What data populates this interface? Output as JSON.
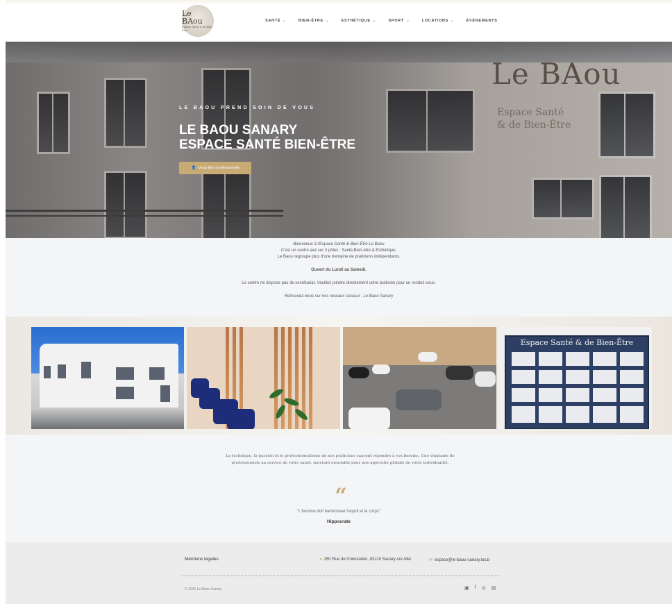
{
  "header": {
    "logo_text": "Le BAou",
    "logo_sub": "Espace Santé & de Bien-Être",
    "nav": [
      {
        "label": "SANTÉ",
        "dropdown": true
      },
      {
        "label": "BIEN-ÊTRE",
        "dropdown": true
      },
      {
        "label": "ESTHÉTIQUE",
        "dropdown": true
      },
      {
        "label": "SPORT",
        "dropdown": true
      },
      {
        "label": "LOCATIONS",
        "dropdown": true
      },
      {
        "label": "ÉVÉNEMENTS",
        "dropdown": false
      }
    ]
  },
  "hero": {
    "sign_main": "Le BAou",
    "sign_sub_1": "Espace Santé",
    "sign_sub_2": "& de Bien-Être",
    "kicker": "LE BAOU PREND SOIN DE VOUS",
    "title_line1": "LE BAOU SANARY",
    "title_line2": "ESPACE SANTÉ BIEN-ÊTRE",
    "cta_label": "Vous êtes professionnel",
    "cta_icon": "user-icon"
  },
  "intro": {
    "line1": "Bienvenue à l'Espace Santé & Bien-Être Le Baou",
    "line2": "C'est un centre axé sur 3 pôles : Santé,Bien-être & Esthétique.",
    "line3": "Le Baou regroupe plus d'une trentaine de praticiens indépendants.",
    "open": "Ouvert du Lundi au Samedi.",
    "notice": "Le centre ne dispose pas de secrétariat. Veuillez joindre directement votre praticien pour un rendez-vous.",
    "social": "Retrouvez-nous sur nos réseaux sociaux : Le Baou Sanary"
  },
  "gallery": {
    "board_title": "Espace Santé & de Bien-Être"
  },
  "quote": {
    "blurb": "La technique, la passion et le professionnalisme de nos praticiens sauront répondre à vos besoins. Une vingtaine de professionnels au service de votre santé, œuvrant ensemble pour une approche globale de votre individualité.",
    "mark": "“",
    "text": "\"L'homme doit harmoniser l'esprit et le corps\"",
    "author": "Hippocrate"
  },
  "footer": {
    "legal": "Mentions légales",
    "address": "250 Rue de l'Innovation, 83110 Sanary-sur-Mer",
    "email": "espace@le-baou-sanary.local",
    "copyright": "© 2025 Le Baou Sanary",
    "socials": [
      "instagram-icon",
      "facebook-icon",
      "instagram-icon",
      "linkedin-icon"
    ]
  },
  "colors": {
    "accent": "#c7aa74",
    "footer_bg": "#ececec",
    "page_bg": "#f4f5f7"
  }
}
